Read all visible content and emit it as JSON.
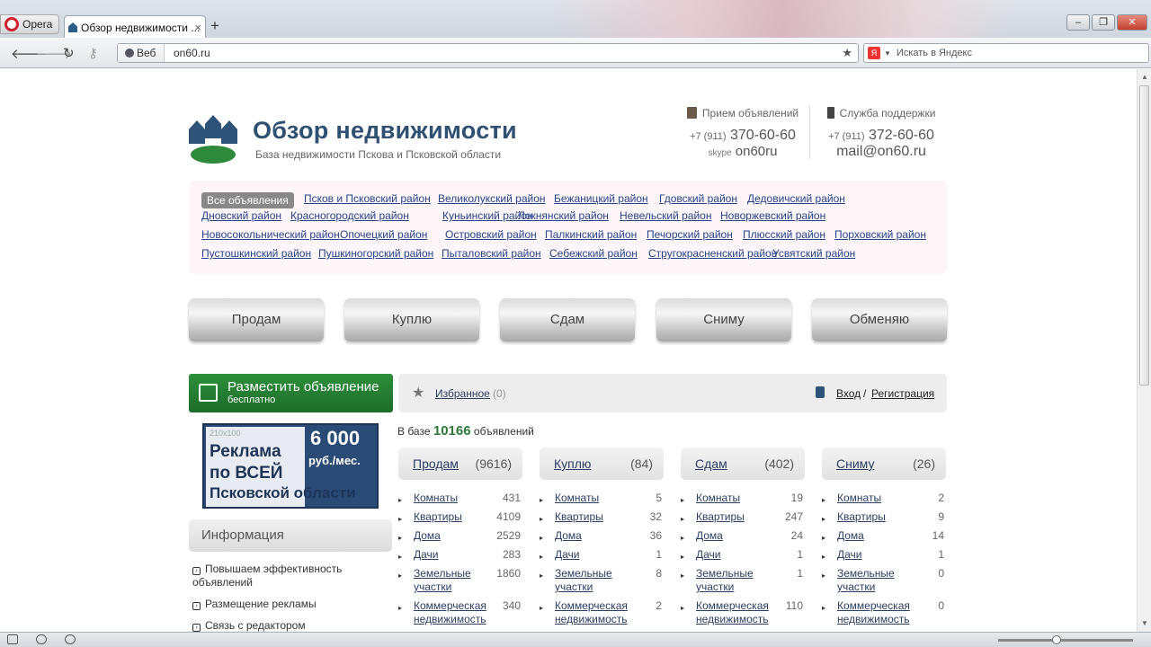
{
  "browser": {
    "menu_label": "Opera",
    "tab_title": "Обзор недвижимости ...",
    "tab_close": "×",
    "new_tab": "+",
    "address_prefix": "Веб",
    "url": "on60.ru",
    "search_placeholder": "Искать в Яндекс",
    "search_engine_letter": "Я"
  },
  "header": {
    "title": "Обзор недвижимости",
    "tagline": "База недвижимости Пскова и Псковской области",
    "ads_label": "Прием объявлений",
    "ads_phone_code": "+7 (911)",
    "ads_phone": "370-60-60",
    "ads_skype_label": "skype",
    "ads_skype": "on60ru",
    "support_label": "Служба поддержки",
    "support_phone_code": "+7 (911)",
    "support_phone": "372-60-60",
    "support_email": "mail@on60.ru"
  },
  "districts": [
    [
      "Все объявления",
      "Псков и Псковский район",
      "Великолукский район",
      "Бежаницкий район",
      "Гдовский район",
      "Дедовичский район"
    ],
    [
      "Дновский район",
      "Красногородский район",
      "Куньинский район",
      "Локнянский район",
      "Невельский район",
      "Новоржевский район"
    ],
    [
      "Новосокольнический район",
      "Опочецкий район",
      "Островский район",
      "Палкинский район",
      "Печорский район",
      "Плюсский район",
      "Порховский район"
    ],
    [
      "Пустошкинский район",
      "Пушкиногорский район",
      "Пыталовский район",
      "Себежский район",
      "Стругокрасненский район",
      "Усвятский район"
    ]
  ],
  "actions": [
    "Продам",
    "Куплю",
    "Сдам",
    "Сниму",
    "Обменяю"
  ],
  "post_ad": {
    "title": "Разместить объявление",
    "subtitle": "бесплатно"
  },
  "ad_banner": {
    "size": "210x100",
    "line1": "Реклама",
    "line2": "по ВСЕЙ",
    "price": "6 000",
    "unit": "руб./мес.",
    "line4": "Псковской области"
  },
  "info": {
    "title": "Информация",
    "items": [
      "Повышаем эффективность объявлений",
      "Размещение рекламы",
      "Связь с редактором"
    ]
  },
  "favorites": {
    "label": "Избранное",
    "count": "(0)",
    "login": "Вход",
    "sep": "/",
    "register": "Регистрация"
  },
  "stats": {
    "prefix": "В базе",
    "total": "10166",
    "suffix": "объявлений"
  },
  "categories": [
    {
      "name": "Продам",
      "count": "(9616)",
      "rows": [
        [
          "Комнаты",
          "431"
        ],
        [
          "Квартиры",
          "4109"
        ],
        [
          "Дома",
          "2529"
        ],
        [
          "Дачи",
          "283"
        ],
        [
          "Земельные участки",
          "1860"
        ],
        [
          "Коммерческая недвижимость",
          "340"
        ]
      ]
    },
    {
      "name": "Куплю",
      "count": "(84)",
      "rows": [
        [
          "Комнаты",
          "5"
        ],
        [
          "Квартиры",
          "32"
        ],
        [
          "Дома",
          "36"
        ],
        [
          "Дачи",
          "1"
        ],
        [
          "Земельные участки",
          "8"
        ],
        [
          "Коммерческая недвижимость",
          "2"
        ]
      ]
    },
    {
      "name": "Сдам",
      "count": "(402)",
      "rows": [
        [
          "Комнаты",
          "19"
        ],
        [
          "Квартиры",
          "247"
        ],
        [
          "Дома",
          "24"
        ],
        [
          "Дачи",
          "1"
        ],
        [
          "Земельные участки",
          "1"
        ],
        [
          "Коммерческая недвижимость",
          "110"
        ]
      ]
    },
    {
      "name": "Сниму",
      "count": "(26)",
      "rows": [
        [
          "Комнаты",
          "2"
        ],
        [
          "Квартиры",
          "9"
        ],
        [
          "Дома",
          "14"
        ],
        [
          "Дачи",
          "1"
        ],
        [
          "Земельные участки",
          "0"
        ],
        [
          "Коммерческая недвижимость",
          "0"
        ]
      ]
    }
  ]
}
